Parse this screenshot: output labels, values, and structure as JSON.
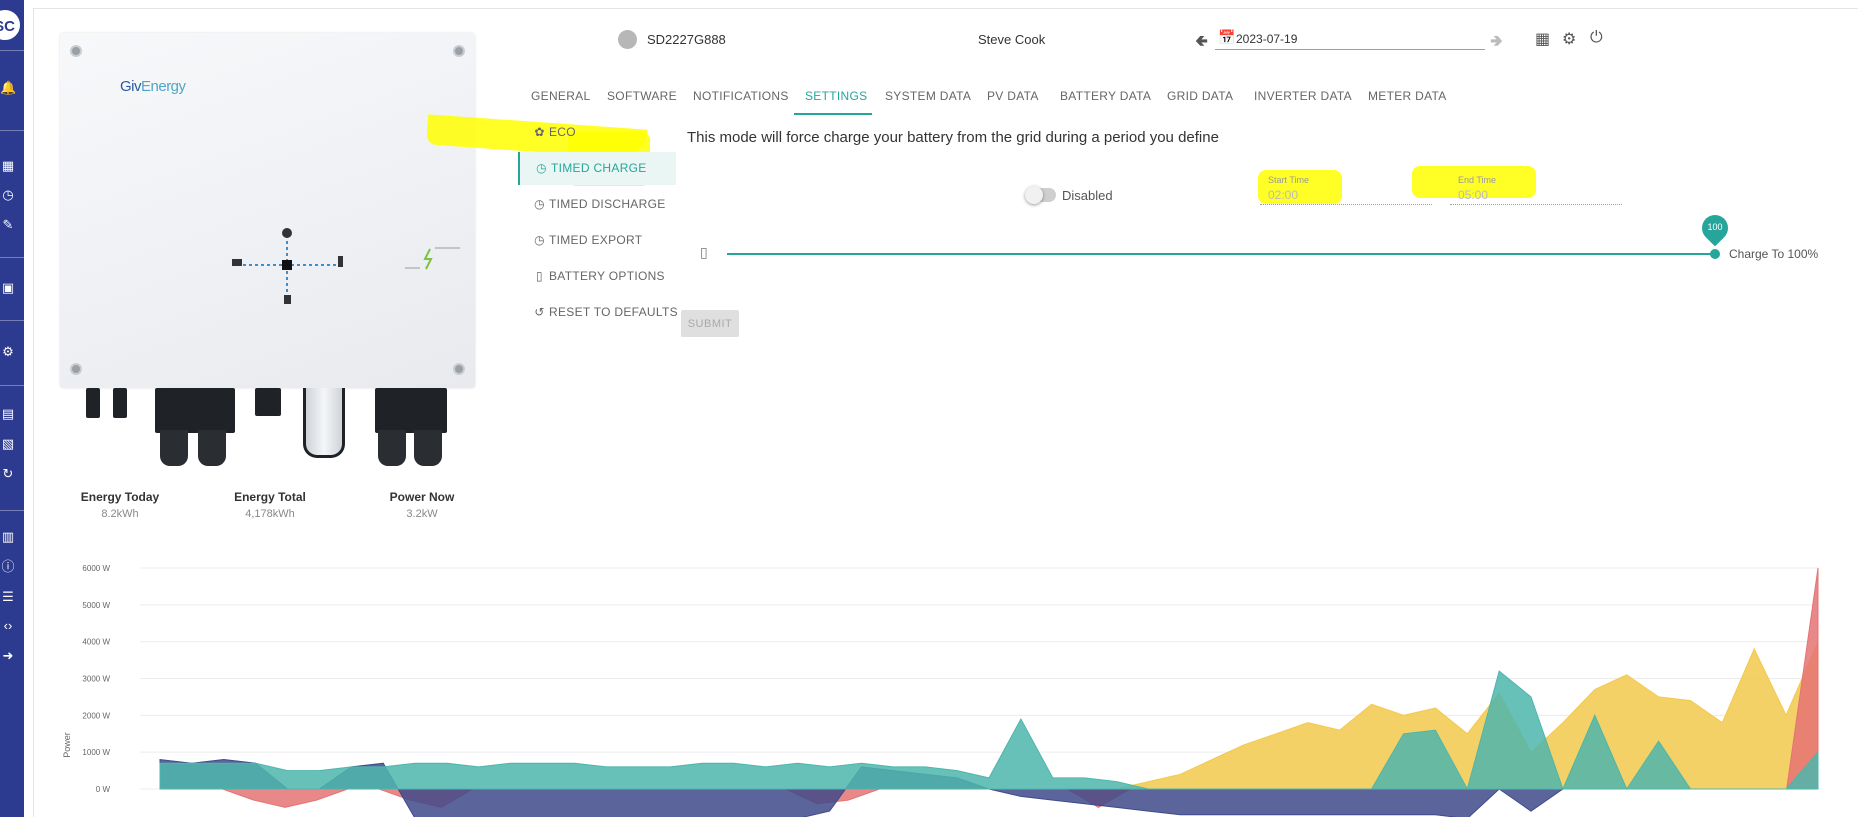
{
  "sidebar": {
    "avatar_initials": "SC",
    "icons": [
      "bell-icon",
      "dashboard-icon",
      "history-icon",
      "edit-icon",
      "monitor-icon",
      "users-gear-icon",
      "chat-icon",
      "message-icon",
      "sync-icon",
      "comments-icon",
      "alert-icon",
      "edit-list-icon",
      "code-icon",
      "logout-icon"
    ]
  },
  "inverter": {
    "brand": "GivEnergy"
  },
  "stats": [
    {
      "label": "Energy Today",
      "value": "8.2kWh"
    },
    {
      "label": "Energy Total",
      "value": "4,178kWh"
    },
    {
      "label": "Power Now",
      "value": "3.2kW"
    }
  ],
  "header": {
    "serial": "SD2227G888",
    "user": "Steve Cook",
    "date": "2023-07-19"
  },
  "tabs": [
    "GENERAL",
    "SOFTWARE",
    "NOTIFICATIONS",
    "SETTINGS",
    "SYSTEM DATA",
    "PV DATA",
    "BATTERY DATA",
    "GRID DATA",
    "INVERTER DATA",
    "METER DATA"
  ],
  "active_tab": "SETTINGS",
  "settings_menu": [
    {
      "label": "ECO",
      "icon": "leaf-icon"
    },
    {
      "label": "TIMED CHARGE",
      "icon": "clock-icon"
    },
    {
      "label": "TIMED DISCHARGE",
      "icon": "clock-icon"
    },
    {
      "label": "TIMED EXPORT",
      "icon": "clock-icon"
    },
    {
      "label": "BATTERY OPTIONS",
      "icon": "battery-icon"
    },
    {
      "label": "RESET TO DEFAULTS",
      "icon": "reset-icon"
    }
  ],
  "timed_charge": {
    "description": "This mode will force charge your battery from the grid during a period you define",
    "toggle_label": "Disabled",
    "start_label": "Start Time",
    "start_value": "02:00",
    "end_label": "End Time",
    "end_value": "05:00",
    "charge_target": 100,
    "charge_label": "Charge To 100%",
    "submit_label": "SUBMIT"
  },
  "colors": {
    "accent": "#26a69a",
    "sidebar": "#2c3b8f",
    "highlight": "#ffff00"
  },
  "chart_data": {
    "type": "area",
    "ylabel": "Power",
    "yticks": [
      "6000 W",
      "5000 W",
      "4000 W",
      "3000 W",
      "2000 W",
      "1000 W",
      "0 W"
    ],
    "ylim": [
      -800,
      6000
    ],
    "n_points": 50,
    "series": [
      {
        "color": "#f2c94c",
        "values": [
          0,
          0,
          0,
          0,
          0,
          0,
          0,
          0,
          0,
          0,
          0,
          0,
          0,
          0,
          0,
          0,
          0,
          0,
          0,
          0,
          0,
          0,
          0,
          0,
          0,
          0,
          0,
          0,
          0,
          0,
          0,
          200,
          400,
          800,
          1200,
          1500,
          1800,
          1600,
          2300,
          2000,
          2200,
          1500,
          2600,
          1000,
          1800,
          2700,
          3100,
          2500,
          2400,
          1800,
          3800,
          2000,
          4000
        ]
      },
      {
        "color": "#e57373",
        "values": [
          0,
          0,
          0,
          -300,
          -500,
          -300,
          0,
          0,
          -300,
          -500,
          0,
          0,
          0,
          0,
          0,
          0,
          0,
          0,
          0,
          0,
          0,
          -400,
          -300,
          0,
          0,
          0,
          0,
          0,
          0,
          0,
          -500,
          0,
          0,
          0,
          0,
          0,
          0,
          0,
          0,
          0,
          0,
          0,
          0,
          0,
          0,
          0,
          0,
          0,
          0,
          0,
          0,
          0,
          0,
          6000
        ]
      },
      {
        "color": "#3f4a8a",
        "values": [
          800,
          700,
          800,
          700,
          0,
          0,
          600,
          700,
          -800,
          -800,
          -800,
          -800,
          -800,
          -800,
          -800,
          -800,
          -800,
          -800,
          -800,
          -800,
          -800,
          -600,
          600,
          500,
          400,
          300,
          0,
          -200,
          -300,
          -400,
          -500,
          -600,
          -700,
          -700,
          -700,
          -700,
          -700,
          -700,
          -700,
          -700,
          -700,
          -800,
          0,
          -600,
          0,
          0,
          0,
          0,
          0,
          0,
          0,
          0,
          0
        ]
      },
      {
        "color": "#4db6ac",
        "values": [
          700,
          700,
          700,
          700,
          500,
          500,
          600,
          600,
          700,
          700,
          600,
          700,
          700,
          700,
          600,
          600,
          600,
          700,
          700,
          600,
          700,
          600,
          700,
          600,
          600,
          500,
          300,
          1900,
          300,
          300,
          200,
          0,
          0,
          0,
          0,
          0,
          0,
          0,
          0,
          1500,
          1600,
          0,
          3200,
          2500,
          0,
          2000,
          0,
          1300,
          0,
          0,
          0,
          0,
          1000
        ]
      }
    ]
  }
}
